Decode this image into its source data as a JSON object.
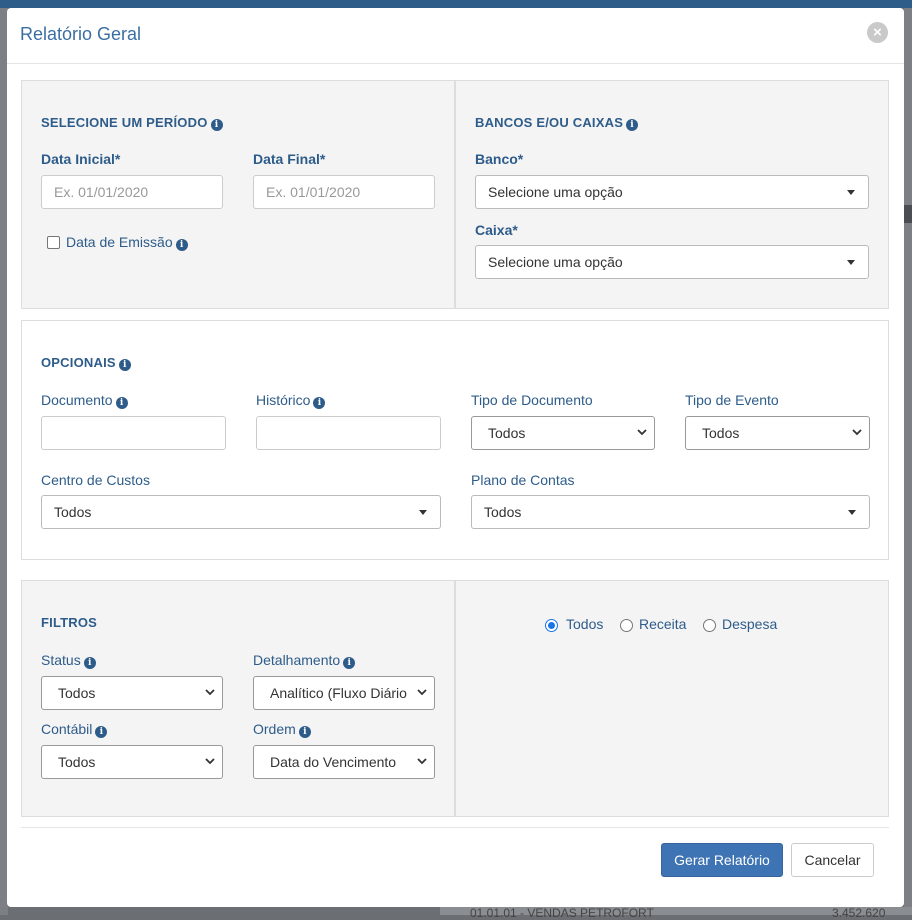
{
  "modal": {
    "title": "Relatório Geral"
  },
  "periodo": {
    "title": "SELECIONE UM PERÍODO",
    "data_inicial_label": "Data Inicial*",
    "data_inicial_placeholder": "Ex. 01/01/2020",
    "data_final_label": "Data Final*",
    "data_final_placeholder": "Ex. 01/01/2020",
    "data_emissao_label": "Data de Emissão"
  },
  "bancos": {
    "title": "BANCOS E/OU CAIXAS",
    "banco_label": "Banco*",
    "banco_value": "Selecione uma opção",
    "caixa_label": "Caixa*",
    "caixa_value": "Selecione uma opção"
  },
  "opcionais": {
    "title": "OPCIONAIS",
    "documento_label": "Documento",
    "historico_label": "Histórico",
    "tipo_documento_label": "Tipo de Documento",
    "tipo_documento_value": "Todos",
    "tipo_evento_label": "Tipo de Evento",
    "tipo_evento_value": "Todos",
    "centro_custos_label": "Centro de Custos",
    "centro_custos_value": "Todos",
    "plano_contas_label": "Plano de Contas",
    "plano_contas_value": "Todos"
  },
  "filtros": {
    "title": "FILTROS",
    "status_label": "Status",
    "status_value": "Todos",
    "detalhamento_label": "Detalhamento",
    "detalhamento_value": "Analítico (Fluxo Diário",
    "contabil_label": "Contábil",
    "contabil_value": "Todos",
    "ordem_label": "Ordem",
    "ordem_value": "Data do Vencimento"
  },
  "tipo": {
    "options": [
      "Todos",
      "Receita",
      "Despesa"
    ],
    "selected": "Todos"
  },
  "footer": {
    "gerar_label": "Gerar Relatório",
    "cancelar_label": "Cancelar"
  },
  "background": {
    "row_text": "01.01.01 - VENDAS PETROFORT",
    "row_value": "3.452.620"
  },
  "colors": {
    "primary": "#3e74b4",
    "label": "#2e5c8a",
    "panel": "#f4f4f4",
    "radio_accent": "#1a73e8"
  }
}
